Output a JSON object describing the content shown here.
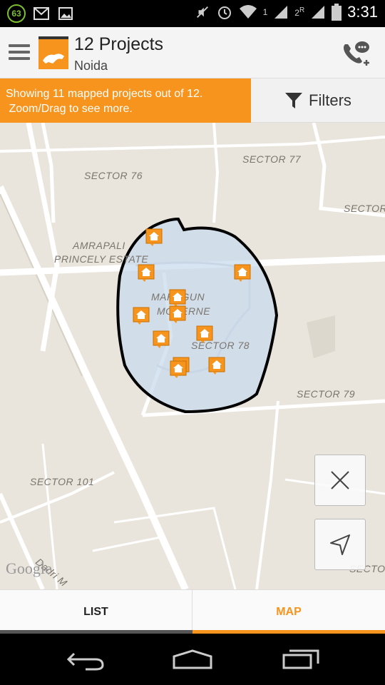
{
  "status_bar": {
    "notification_count": "63",
    "sim1_label": "1",
    "sim2_label": "2",
    "roaming": "R",
    "time": "3:31"
  },
  "app_bar": {
    "title": "12 Projects",
    "subtitle": "Noida"
  },
  "banner": {
    "line1": "Showing 11 mapped projects out of 12.",
    "line2": " Zoom/Drag to see more."
  },
  "filters": {
    "label": "Filters"
  },
  "map": {
    "labels": {
      "sector76": "SECTOR 76",
      "sector77": "SECTOR 77",
      "sector_right": "SECTOR",
      "amrapali1": "AMRAPALI",
      "amrapali2": "PRINCELY ESTATE",
      "mahagun1": "MAHAGUN",
      "mahagun2": "MODERNE",
      "sector78": "SECTOR 78",
      "sector79": "SECTOR 79",
      "sector101": "SECTOR 101",
      "sector_bottom": "SECTOR",
      "dadri": "Dadri M"
    },
    "google_logo": "Google",
    "accent_color": "#f7941d"
  },
  "tabs": {
    "list_label": "LIST",
    "map_label": "MAP"
  }
}
